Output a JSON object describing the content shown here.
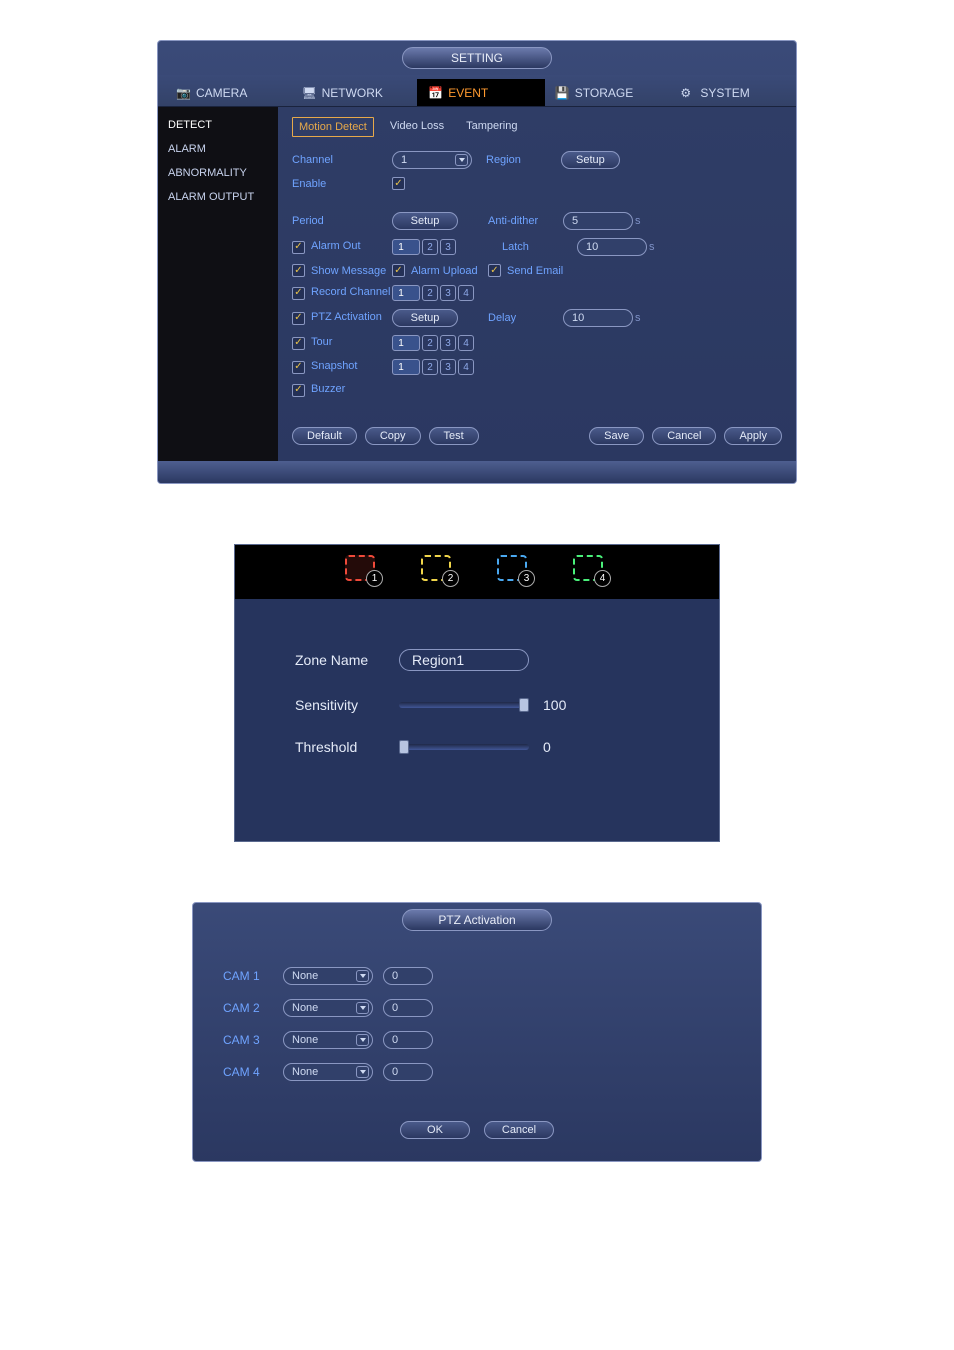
{
  "setting": {
    "title": "SETTING",
    "tabs": [
      "CAMERA",
      "NETWORK",
      "EVENT",
      "STORAGE",
      "SYSTEM"
    ],
    "active_tab": 2,
    "sidebar": [
      "DETECT",
      "ALARM",
      "ABNORMALITY",
      "ALARM OUTPUT"
    ],
    "sidebar_active": 0,
    "subtabs": [
      "Motion Detect",
      "Video Loss",
      "Tampering"
    ],
    "subtab_active": 0,
    "labels": {
      "channel": "Channel",
      "region": "Region",
      "enable": "Enable",
      "period": "Period",
      "antidither": "Anti-dither",
      "alarmout": "Alarm Out",
      "latch": "Latch",
      "showmsg": "Show Message",
      "alarmupload": "Alarm Upload",
      "sendemail": "Send Email",
      "recordch": "Record Channel",
      "ptzact": "PTZ Activation",
      "delay": "Delay",
      "tour": "Tour",
      "snapshot": "Snapshot",
      "buzzer": "Buzzer",
      "s": "s"
    },
    "values": {
      "channel": "1",
      "antidither": "5",
      "latch": "10",
      "delay": "10"
    },
    "buttons": {
      "setup": "Setup",
      "default": "Default",
      "copy": "Copy",
      "test": "Test",
      "save": "Save",
      "cancel": "Cancel",
      "apply": "Apply"
    }
  },
  "zone": {
    "tabcolors": [
      "#f04a3a",
      "#f0d54a",
      "#4aa8f0",
      "#4af07a"
    ],
    "active": 0,
    "zoneNameLabel": "Zone Name",
    "zoneName": "Region1",
    "sensitivityLabel": "Sensitivity",
    "sensitivity": 100,
    "thresholdLabel": "Threshold",
    "threshold": 0
  },
  "ptz": {
    "title": "PTZ Activation",
    "cams": [
      {
        "label": "CAM 1",
        "preset": "None",
        "num": "0"
      },
      {
        "label": "CAM 2",
        "preset": "None",
        "num": "0"
      },
      {
        "label": "CAM 3",
        "preset": "None",
        "num": "0"
      },
      {
        "label": "CAM 4",
        "preset": "None",
        "num": "0"
      }
    ],
    "ok": "OK",
    "cancel": "Cancel"
  }
}
